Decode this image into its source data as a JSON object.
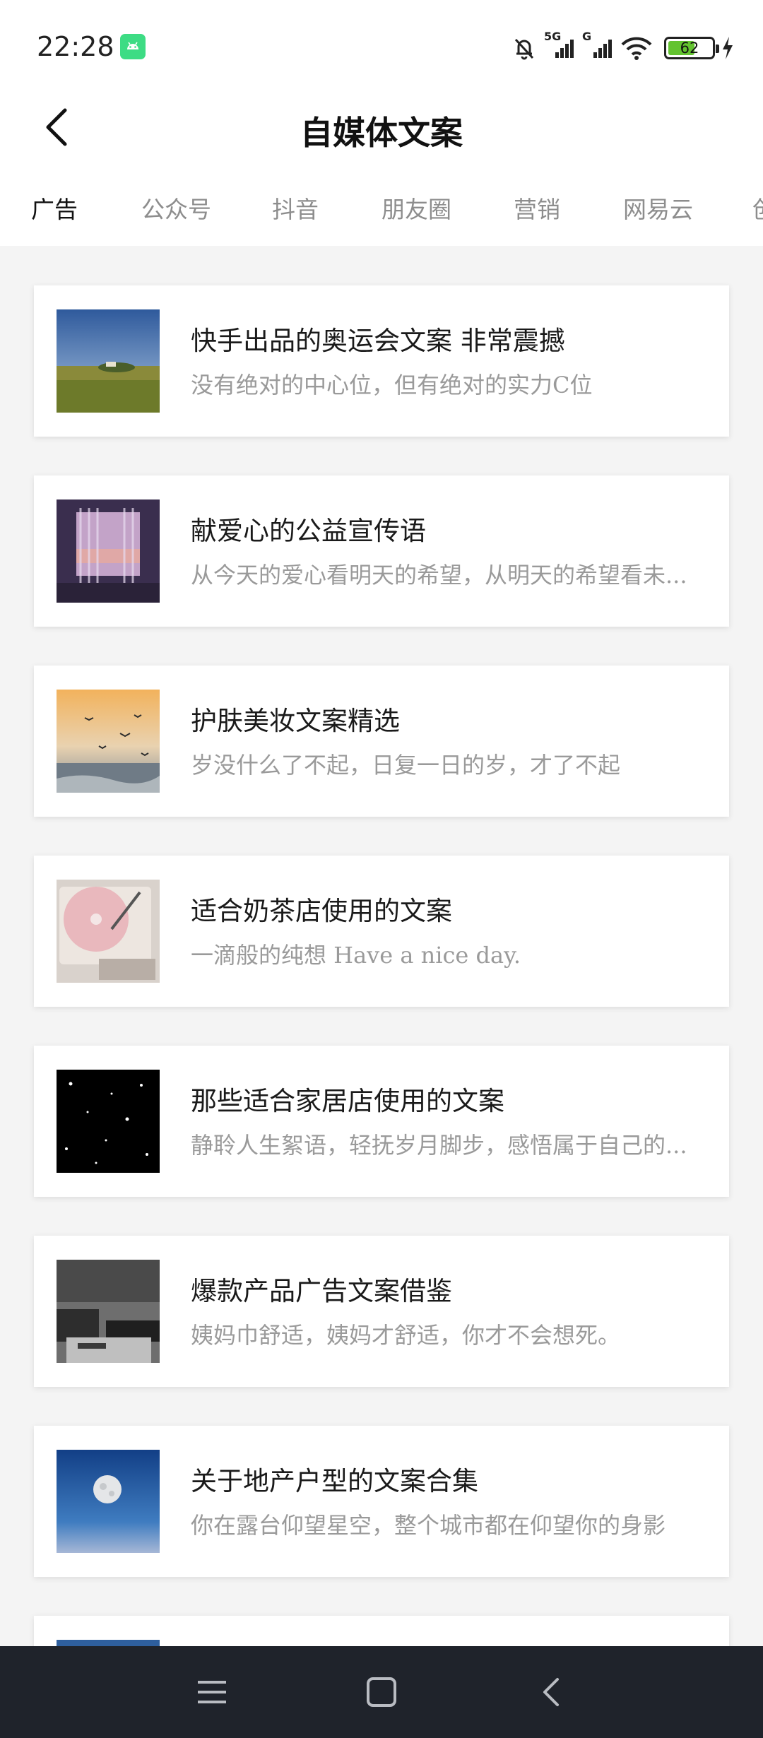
{
  "status_bar": {
    "time": "22:28",
    "signal_1_label": "5G",
    "signal_2_label": "G",
    "battery_level": "62",
    "icons": [
      "android-notification-icon",
      "mute-bell-icon",
      "cell-signal-icon",
      "wifi-icon",
      "battery-icon",
      "charging-icon"
    ]
  },
  "header": {
    "title": "自媒体文案",
    "back_icon": "chevron-left-icon"
  },
  "tabs": [
    {
      "label": "广告",
      "active": true
    },
    {
      "label": "公众号",
      "active": false
    },
    {
      "label": "抖音",
      "active": false
    },
    {
      "label": "朋友圈",
      "active": false
    },
    {
      "label": "营销",
      "active": false
    },
    {
      "label": "网易云",
      "active": false
    },
    {
      "label": "创",
      "active": false
    }
  ],
  "articles": [
    {
      "title": "快手出品的奥运会文案 非常震撼",
      "subtitle": "没有绝对的中心位，但有绝对的实力C位",
      "thumb": "landscape-field"
    },
    {
      "title": "献爱心的公益宣传语",
      "subtitle": "从今天的爱心看明天的希望，从明天的希望看未...",
      "thumb": "curtain-window"
    },
    {
      "title": "护肤美妆文案精选",
      "subtitle": "岁没什么了不起，日复一日的岁，才了不起",
      "thumb": "seagulls-sunset"
    },
    {
      "title": "适合奶茶店使用的文案",
      "subtitle": " 一滴般的纯想 Have a nice day.",
      "thumb": "pink-record-player"
    },
    {
      "title": "那些适合家居店使用的文案",
      "subtitle": "静聆人生絮语，轻抚岁月脚步，感悟属于自己的...",
      "thumb": "starry-night"
    },
    {
      "title": "爆款产品广告文案借鉴",
      "subtitle": "姨妈巾舒适，姨妈才舒适，你才不会想死。",
      "thumb": "dark-living-room"
    },
    {
      "title": "关于地产户型的文案合集",
      "subtitle": "你在露台仰望星空，整个城市都在仰望你的身影",
      "thumb": "moon-blue-sky"
    },
    {
      "title": "",
      "subtitle": "",
      "thumb": "blue-sky"
    }
  ],
  "nav_bar": {
    "icons": [
      "menu-icon",
      "home-square-icon",
      "back-triangle-icon"
    ]
  },
  "colors": {
    "background": "#f4f4f4",
    "tab_active": "#111111",
    "tab_inactive": "#8d8d8d",
    "subtitle": "#9a9a9a",
    "nav_bar": "#1f232b",
    "battery_fill": "#63c330",
    "android_badge": "#3ddc84"
  }
}
